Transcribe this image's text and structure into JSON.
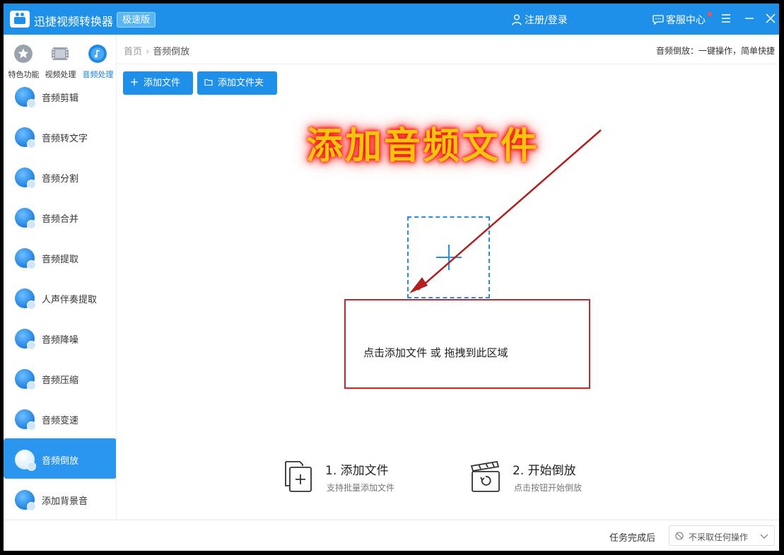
{
  "app": {
    "title": "迅捷视频转换器",
    "badge": "极速版",
    "login": "注册/登录",
    "service": "客服中心"
  },
  "categories": [
    {
      "label": "特色功能",
      "icon": "star-icon"
    },
    {
      "label": "视频处理",
      "icon": "film-icon"
    },
    {
      "label": "音频处理",
      "icon": "music-icon",
      "active": true
    }
  ],
  "sidebar": {
    "items": [
      {
        "label": "音频剪辑"
      },
      {
        "label": "音频转文字"
      },
      {
        "label": "音频分割"
      },
      {
        "label": "音频合并"
      },
      {
        "label": "音频提取"
      },
      {
        "label": "人声伴奏提取"
      },
      {
        "label": "音频降噪"
      },
      {
        "label": "音频压缩"
      },
      {
        "label": "音频变速"
      },
      {
        "label": "音频倒放",
        "active": true
      },
      {
        "label": "添加背景音"
      }
    ]
  },
  "breadcrumb": {
    "home": "首页",
    "current": "音频倒放"
  },
  "hint": "音频倒放：一键操作，简单快捷",
  "toolbar": {
    "add_file": "添加文件",
    "add_folder": "添加文件夹"
  },
  "annotation": {
    "title": "添加音频文件"
  },
  "dropzone": {
    "text": "点击添加文件 或 拖拽到此区域"
  },
  "steps": [
    {
      "title": "1. 添加文件",
      "subtitle": "支持批量添加文件"
    },
    {
      "title": "2. 开始倒放",
      "subtitle": "点击按钮开始倒放"
    }
  ],
  "footer": {
    "after_label": "任务完成后",
    "after_value": "不采取任何操作"
  },
  "colors": {
    "accent": "#1f90ea",
    "annotation_red": "#c62828",
    "annotation_gold": "#f5c40f"
  }
}
